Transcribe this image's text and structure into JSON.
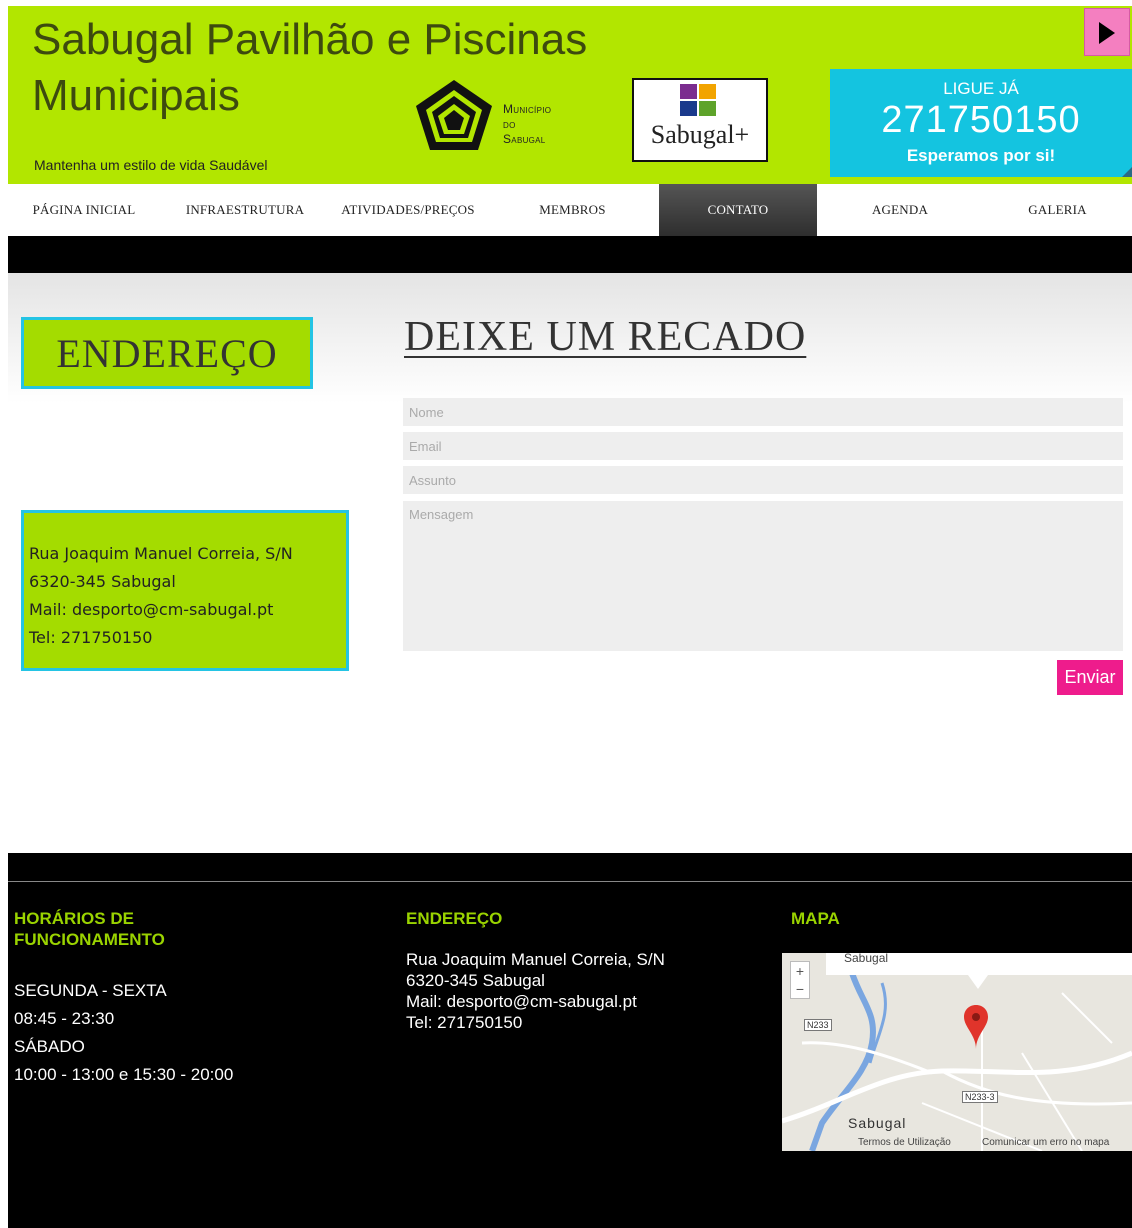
{
  "header": {
    "title": "Sabugal Pavilhão e Piscinas Municipais",
    "tagline": "Mantenha um estilo de vida Saudável",
    "municipio_logo_text": [
      "Município",
      "do",
      "Sabugal"
    ],
    "sabugal_logo_text": "Sabugal+",
    "call": {
      "line1": "LIGUE JÁ",
      "phone": "271750150",
      "line3": "Esperamos por si!"
    },
    "colors": {
      "brand_green": "#b2e600",
      "call_blue": "#14c4e0",
      "accent_pink": "#ee1c8c"
    }
  },
  "nav": {
    "items": [
      {
        "label": "Página Inicial"
      },
      {
        "label": "Infraestrutura"
      },
      {
        "label": "Atividades/Preços"
      },
      {
        "label": "Membros"
      },
      {
        "label": "Contato",
        "active": true
      },
      {
        "label": "Agenda"
      },
      {
        "label": "Galeria"
      }
    ]
  },
  "main": {
    "endereco_title": "ENDEREÇO",
    "address_lines": [
      "Rua Joaquim Manuel Correia, S/N",
      "6320-345 Sabugal",
      "Mail: desporto@cm-sabugal.pt",
      "Tel: 271750150"
    ],
    "form": {
      "title": "DEIXE UM RECADO",
      "name_placeholder": "Nome",
      "email_placeholder": "Email",
      "subject_placeholder": "Assunto",
      "message_placeholder": "Mensagem",
      "submit_label": "Enviar"
    }
  },
  "footer": {
    "hours": {
      "heading": "HORÁRIOS DE FUNCIONAMENTO",
      "lines": [
        "SEGUNDA - SEXTA",
        "08:45 - 23:30",
        "SÁBADO",
        "10:00 - 13:00 e 15:30 - 20:00"
      ]
    },
    "address": {
      "heading": "ENDEREÇO",
      "lines": [
        "Rua Joaquim Manuel Correia, S/N",
        "6320-345 Sabugal",
        "Mail: desporto@cm-sabugal.pt",
        "Tel: 271750150"
      ]
    },
    "map": {
      "heading": "MAPA",
      "bubble_text": "Sabugal",
      "zoom_in": "+",
      "zoom_out": "−",
      "road_labels": [
        "N233",
        "N233-3"
      ],
      "place_label": "Sabugal",
      "terms_link": "Termos de Utilização",
      "report_link": "Comunicar um erro no mapa",
      "icons": [
        "zoom-in-icon",
        "zoom-out-icon",
        "map-pin-icon"
      ]
    }
  }
}
